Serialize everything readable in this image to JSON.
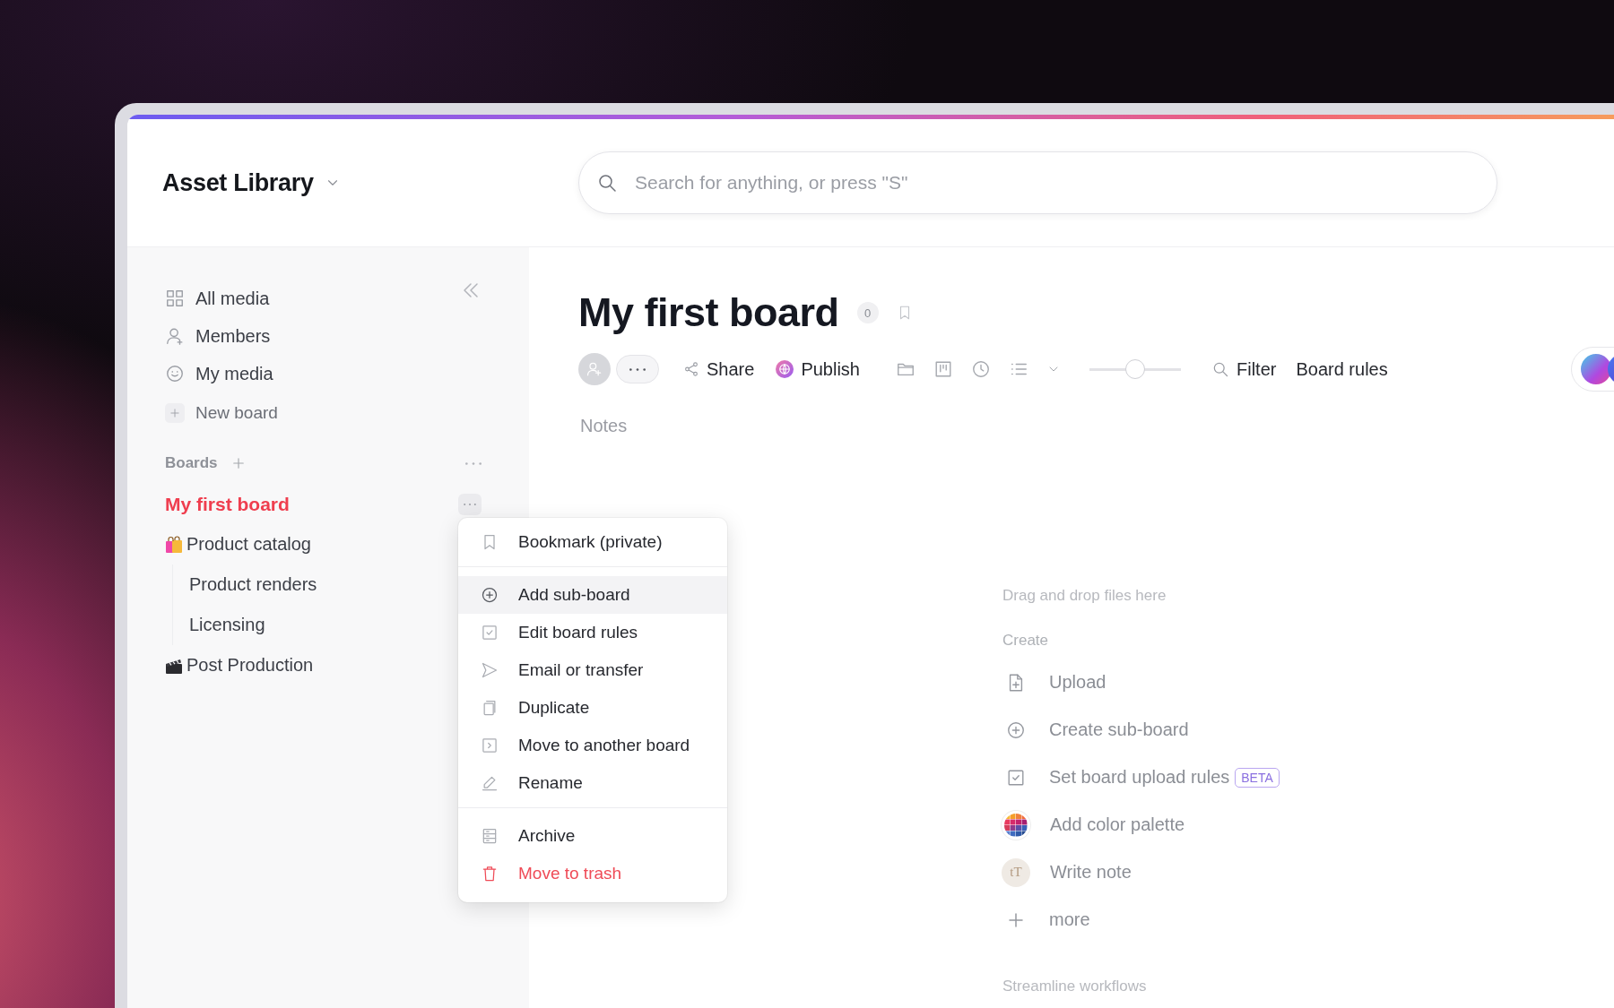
{
  "header": {
    "title": "Asset Library",
    "search": {
      "placeholder": "Search for anything, or press \"S\""
    }
  },
  "sidebar": {
    "nav": [
      {
        "label": "All media",
        "kind": "link"
      },
      {
        "label": "Members",
        "kind": "link"
      },
      {
        "label": "My media",
        "kind": "link"
      },
      {
        "label": "New board",
        "kind": "action"
      }
    ],
    "boards_label": "Boards",
    "boards": [
      {
        "label": "My first board",
        "selected": true
      },
      {
        "label": "Product catalog",
        "selected": false,
        "children": [
          {
            "label": "Product renders",
            "selected": false
          },
          {
            "label": "Licensing",
            "selected": false
          }
        ]
      },
      {
        "label": "Post Production",
        "selected": false
      }
    ]
  },
  "context_menu": {
    "groups": [
      {
        "items": [
          {
            "label": "Bookmark (private)",
            "kind": "normal",
            "highlighted": false
          }
        ]
      },
      {
        "items": [
          {
            "label": "Add sub-board",
            "kind": "normal",
            "highlighted": true
          },
          {
            "label": "Edit board rules",
            "kind": "normal",
            "highlighted": false
          },
          {
            "label": "Email or transfer",
            "kind": "normal",
            "highlighted": false
          },
          {
            "label": "Duplicate",
            "kind": "normal",
            "highlighted": false
          },
          {
            "label": "Move to another board",
            "kind": "normal",
            "highlighted": false
          },
          {
            "label": "Rename",
            "kind": "normal",
            "highlighted": false
          }
        ]
      },
      {
        "items": [
          {
            "label": "Archive",
            "kind": "normal",
            "highlighted": false
          },
          {
            "label": "Move to trash",
            "kind": "danger",
            "highlighted": false
          }
        ]
      }
    ]
  },
  "board": {
    "title": "My first board",
    "count": "0",
    "toolbar": {
      "share": "Share",
      "publish": "Publish",
      "zoom": {
        "level": 0.5
      },
      "filter": "Filter",
      "rules": "Board rules"
    },
    "notes": {
      "placeholder": "Notes"
    }
  },
  "dropzone": {
    "hint": "Drag and drop files here",
    "create_label": "Create",
    "actions": [
      {
        "label": "Upload"
      },
      {
        "label": "Create sub-board"
      },
      {
        "label": "Set board upload rules",
        "badge": "BETA"
      },
      {
        "label": "Add color palette"
      },
      {
        "label": "Write note",
        "icon_text": "tT"
      },
      {
        "label": "more"
      }
    ],
    "streamline_label": "Streamline workflows"
  }
}
